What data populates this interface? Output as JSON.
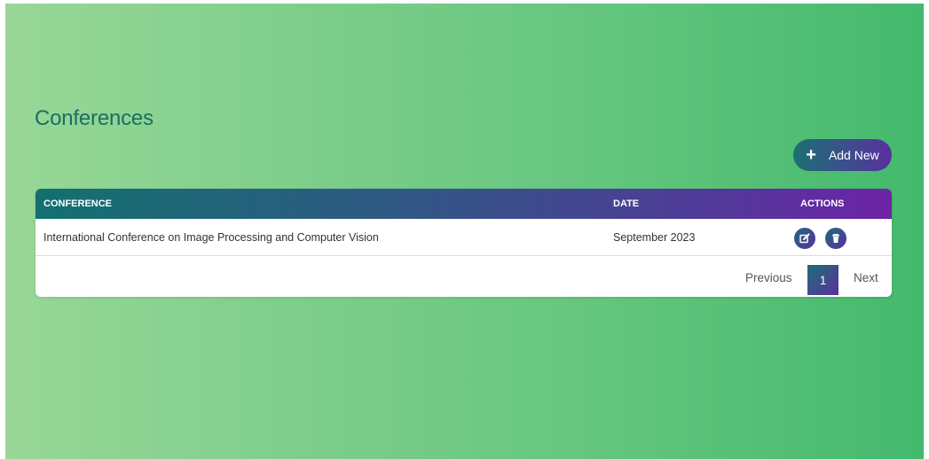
{
  "page": {
    "title": "Conferences"
  },
  "toolbar": {
    "add_label": "Add New",
    "add_icon": "plus-icon"
  },
  "table": {
    "columns": [
      "CONFERENCE",
      "DATE",
      "ACTIONS"
    ],
    "rows": [
      {
        "conference": "International Conference on Image Processing and Computer Vision",
        "date": "September 2023",
        "actions": [
          "edit-icon",
          "trash-icon"
        ]
      }
    ]
  },
  "pagination": {
    "previous": "Previous",
    "current": "1",
    "next": "Next"
  },
  "colors": {
    "title": "#1a6f63",
    "accent_start": "#1d6f73",
    "accent_end": "#6c23a6",
    "background": "#5fc47c"
  }
}
